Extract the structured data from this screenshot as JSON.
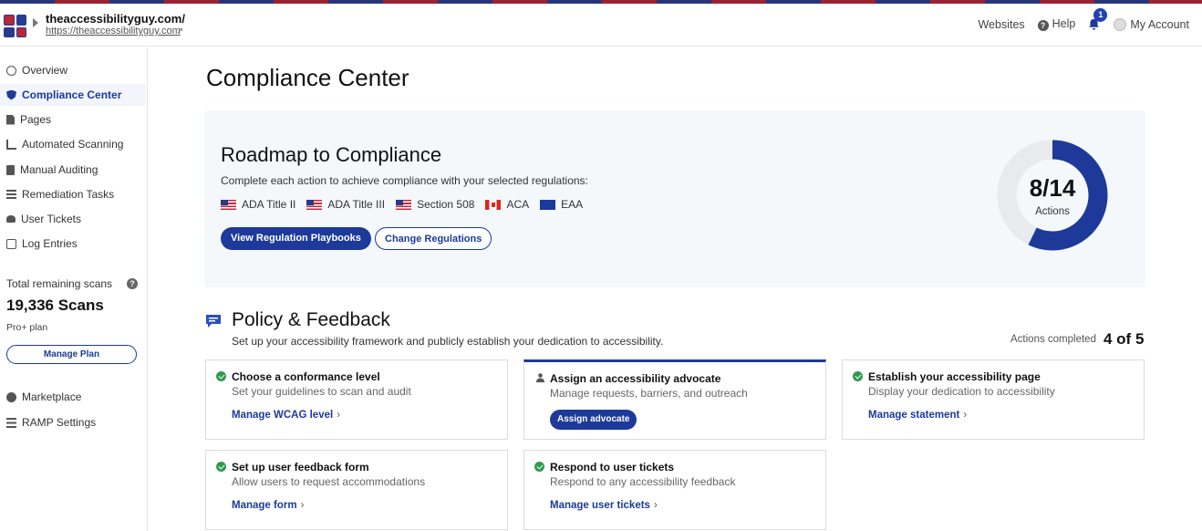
{
  "header": {
    "site_name": "theaccessibilityguy.com/",
    "site_url": "https://theaccessibilityguy.com",
    "nav": {
      "websites": "Websites",
      "help": "Help",
      "notifications_count": "1",
      "account": "My Account"
    }
  },
  "sidebar": {
    "items": [
      {
        "label": "Overview",
        "icon": "overview-icon",
        "active": false
      },
      {
        "label": "Compliance Center",
        "icon": "shield-icon",
        "active": true
      },
      {
        "label": "Pages",
        "icon": "document-icon",
        "active": false
      },
      {
        "label": "Automated Scanning",
        "icon": "chart-icon",
        "active": false
      },
      {
        "label": "Manual Auditing",
        "icon": "clipboard-icon",
        "active": false
      },
      {
        "label": "Remediation Tasks",
        "icon": "task-list-icon",
        "active": false
      },
      {
        "label": "User Tickets",
        "icon": "users-icon",
        "active": false
      },
      {
        "label": "Log Entries",
        "icon": "log-icon",
        "active": false
      }
    ],
    "scans_title": "Total remaining scans",
    "scans_value": "19,336 Scans",
    "plan_name": "Pro+ plan",
    "manage_plan": "Manage Plan",
    "extra_items": [
      {
        "label": "Marketplace",
        "icon": "plus-circle-icon"
      },
      {
        "label": "RAMP Settings",
        "icon": "sliders-icon"
      }
    ]
  },
  "main": {
    "title": "Compliance Center",
    "roadmap": {
      "title": "Roadmap to Compliance",
      "description": "Complete each action to achieve compliance with your selected regulations:",
      "regulations": [
        {
          "label": "ADA Title II",
          "flag": "us-flag"
        },
        {
          "label": "ADA Title III",
          "flag": "us-flag"
        },
        {
          "label": "Section 508",
          "flag": "us-flag"
        },
        {
          "label": "ACA",
          "flag": "canada-flag"
        },
        {
          "label": "EAA",
          "flag": "eu-flag"
        }
      ],
      "primary_button": "View Regulation Playbooks",
      "secondary_button": "Change Regulations",
      "progress_value": "8/14",
      "progress_label": "Actions",
      "progress_completed": 8,
      "progress_total": 14,
      "progress_color": "#1d3a9a",
      "progress_track_color": "#e8eaed"
    },
    "policy": {
      "title": "Policy & Feedback",
      "description": "Set up your accessibility framework and publicly establish your dedication to accessibility.",
      "completed_label": "Actions completed",
      "completed_value": "4 of 5",
      "cards": [
        {
          "title": "Choose a conformance level",
          "subtitle": "Set your guidelines to scan and audit",
          "link": "Manage WCAG level",
          "done": true
        },
        {
          "title": "Assign an accessibility advocate",
          "subtitle": "Manage requests, barriers, and outreach",
          "button": "Assign advocate",
          "done": false
        },
        {
          "title": "Establish your accessibility page",
          "subtitle": "Display your dedication to accessibility",
          "link": "Manage statement",
          "done": true
        },
        {
          "title": "Set up user feedback form",
          "subtitle": "Allow users to request accommodations",
          "link": "Manage form",
          "done": true
        },
        {
          "title": "Respond to user tickets",
          "subtitle": "Respond to any accessibility feedback",
          "link": "Manage user tickets",
          "done": true
        }
      ]
    }
  },
  "colors": {
    "accent": "#1d3a9a",
    "success": "#2f9a4e"
  }
}
